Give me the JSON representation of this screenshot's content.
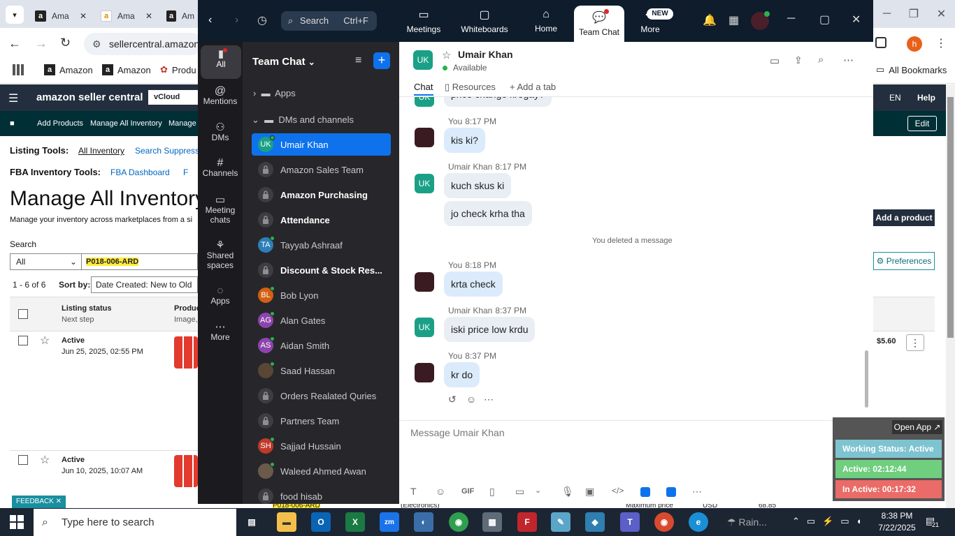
{
  "chrome": {
    "tabs": [
      {
        "label": "Ama"
      },
      {
        "label": "Ama"
      },
      {
        "label": "Am"
      }
    ],
    "url": "sellercentral.amazon",
    "bookmarks": [
      "Amazon",
      "Amazon",
      "Produ"
    ],
    "all_bookmarks": "All Bookmarks",
    "profile_letter": "h"
  },
  "amazon": {
    "logo": "amazon seller central",
    "vcloud": "vCloud Choic",
    "lang": "EN",
    "help": "Help",
    "sub_links": [
      "Add Products",
      "Manage All Inventory",
      "Manage C"
    ],
    "edit": "Edit",
    "listing_tools_label": "Listing Tools:",
    "all_inventory": "All Inventory",
    "search_suppressed": "Search Suppresse",
    "fba_tools_label": "FBA Inventory Tools:",
    "fba_dashboard": "FBA Dashboard",
    "fba_f": "F",
    "title": "Manage All Inventory",
    "subtitle": "Manage your inventory across marketplaces from a si",
    "search_label": "Search",
    "search_scope": "All",
    "search_value": "P018-006-ARD",
    "add_product": "Add a product",
    "preferences": "Preferences",
    "results": "1 - 6 of 6",
    "sort_by": "Sort by:",
    "sort_value": "Date Created: New to Old",
    "col_listing_status": "Listing status",
    "col_next_step": "Next step",
    "col_product": "Produc",
    "col_image": "Image,",
    "rows": [
      {
        "status": "Active",
        "date": "Jun 25, 2025, 02:55 PM",
        "price": "$5.60"
      },
      {
        "status": "Active",
        "date": "Jun 10, 2025, 10:07 AM"
      }
    ],
    "feedback": "FEEDBACK",
    "bottom_sku": "P018-006-ARD",
    "bottom_electronics": "(Electronics)",
    "bottom_max_price": "Maximum price",
    "bottom_usd": "USD",
    "bottom_price": "68.85"
  },
  "zoom": {
    "search_placeholder": "Search",
    "search_shortcut": "Ctrl+F",
    "nav": [
      {
        "label": "Meetings",
        "icon": "video-icon"
      },
      {
        "label": "Whiteboards",
        "icon": "whiteboard-icon"
      },
      {
        "label": "Home",
        "icon": "home-icon"
      },
      {
        "label": "Team Chat",
        "icon": "chat-icon"
      },
      {
        "label": "More",
        "icon": "more-icon"
      }
    ],
    "new_badge": "NEW",
    "rail": [
      {
        "label": "All"
      },
      {
        "label": "Mentions"
      },
      {
        "label": "DMs"
      },
      {
        "label": "Channels"
      },
      {
        "label": "Meeting chats"
      },
      {
        "label": "Shared spaces"
      },
      {
        "label": "Apps"
      },
      {
        "label": "More"
      }
    ],
    "list_title": "Team Chat",
    "apps_label": "Apps",
    "dms_label": "DMs and channels",
    "list_items": [
      {
        "name": "Umair Khan",
        "initials": "UK",
        "type": "avatar",
        "color": "#1aa086",
        "selected": true,
        "bold": false
      },
      {
        "name": "Amazon Sales Team",
        "type": "lock",
        "bold": false
      },
      {
        "name": "Amazon Purchasing",
        "type": "lock",
        "bold": true
      },
      {
        "name": "Attendance",
        "type": "lock",
        "bold": true
      },
      {
        "name": "Tayyab Ashraaf",
        "initials": "TA",
        "type": "avatar",
        "color": "#2d7fb8",
        "bold": false
      },
      {
        "name": "Discount & Stock Res...",
        "type": "lock",
        "bold": true
      },
      {
        "name": "Bob Lyon",
        "initials": "BL",
        "type": "avatar",
        "color": "#d35f13",
        "bold": false
      },
      {
        "name": "Alan Gates",
        "initials": "AG",
        "type": "avatar",
        "color": "#8e44ad",
        "bold": false
      },
      {
        "name": "Aidan Smith",
        "initials": "AS",
        "type": "avatar",
        "color": "#8e44ad",
        "bold": false
      },
      {
        "name": "Saad Hassan",
        "initials": "",
        "type": "avatar",
        "color": "#5a4636",
        "bold": false
      },
      {
        "name": "Orders Realated Quries",
        "type": "lock",
        "bold": false
      },
      {
        "name": "Partners Team",
        "type": "lock",
        "bold": false
      },
      {
        "name": "Sajjad Hussain",
        "initials": "SH",
        "type": "avatar",
        "color": "#c0392b",
        "bold": false
      },
      {
        "name": "Waleed Ahmed Awan",
        "initials": "",
        "type": "avatar",
        "color": "#6b5a4a",
        "bold": false
      },
      {
        "name": "food hisab",
        "type": "lock",
        "bold": false
      }
    ],
    "chat": {
      "contact_initials": "UK",
      "contact_name": "Umair Khan",
      "presence": "Available",
      "tabs": [
        "Chat",
        "Resources",
        "Add a tab"
      ],
      "partial_top": "price change krogay?",
      "messages": [
        {
          "sender": "You",
          "time": "8:17 PM",
          "texts": [
            "kis ki?"
          ],
          "me": true
        },
        {
          "sender": "Umair Khan",
          "time": "8:17 PM",
          "texts": [
            "kuch skus ki",
            "jo check krha tha"
          ],
          "me": false
        },
        {
          "sender": "You",
          "time": "8:18 PM",
          "texts": [
            "krta check"
          ],
          "me": true
        },
        {
          "sender": "Umair Khan",
          "time": "8:37 PM",
          "texts": [
            "iski price low krdu"
          ],
          "me": false
        },
        {
          "sender": "You",
          "time": "8:37 PM",
          "texts": [
            "kr do"
          ],
          "me": true
        }
      ],
      "deleted_note": "You deleted a message",
      "composer_placeholder": "Message Umair Khan",
      "gif": "GIF"
    }
  },
  "widget": {
    "open_app": "Open App",
    "working_status": "Working Status: Active",
    "active": "Active: 02:12:44",
    "inactive": "In Active: 00:17:32",
    "colors": {
      "working": "#7ec3d0",
      "active": "#6fcf7f",
      "inactive": "#ea6b67"
    }
  },
  "taskbar": {
    "search_placeholder": "Type here to search",
    "weather": "Rain...",
    "time": "8:38 PM",
    "date": "7/22/2025",
    "notif_count": "21"
  }
}
